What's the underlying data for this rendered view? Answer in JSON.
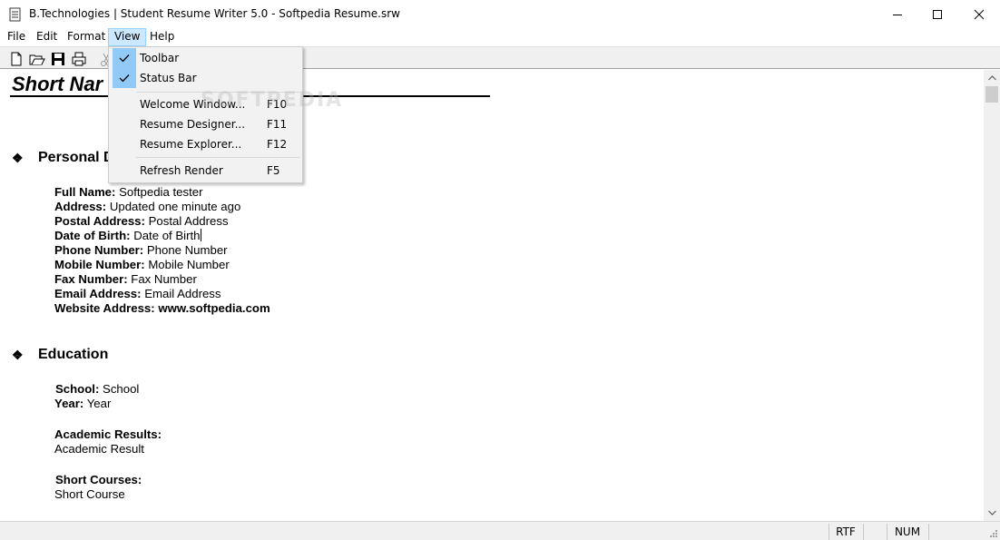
{
  "window": {
    "title": "B.Technologies | Student Resume Writer 5.0 - Softpedia Resume.srw",
    "icons": {
      "app": "document-app-icon",
      "minimize": "minimize-icon",
      "maximize": "maximize-icon",
      "close": "close-icon"
    }
  },
  "menubar": {
    "items": [
      "File",
      "Edit",
      "Format",
      "View",
      "Help"
    ],
    "active": "View"
  },
  "toolbar": {
    "buttons": [
      "new-file-icon",
      "open-folder-icon",
      "save-disk-icon",
      "print-icon",
      "cut-scissors-icon"
    ]
  },
  "view_menu": {
    "items": [
      {
        "label": "Toolbar",
        "shortcut": "",
        "checked": true
      },
      {
        "label": "Status Bar",
        "shortcut": "",
        "checked": true
      },
      {
        "label": "Welcome Window...",
        "shortcut": "F10",
        "checked": false
      },
      {
        "label": "Resume Designer...",
        "shortcut": "F11",
        "checked": false
      },
      {
        "label": "Resume Explorer...",
        "shortcut": "F12",
        "checked": false
      },
      {
        "label": "Refresh Render",
        "shortcut": "F5",
        "checked": false
      }
    ]
  },
  "document": {
    "title": "Short Nar",
    "personal": {
      "heading": "Personal D",
      "fields": [
        {
          "label": "Full Name:",
          "value": "Softpedia tester"
        },
        {
          "label": "Address:",
          "value": "Updated one minute ago"
        },
        {
          "label": "Postal Address:",
          "value": "Postal Address"
        },
        {
          "label": "Date of Birth:",
          "value": "Date of Birth"
        },
        {
          "label": "Phone Number:",
          "value": "Phone Number"
        },
        {
          "label": "Mobile Number:",
          "value": "Mobile Number"
        },
        {
          "label": "Fax Number:",
          "value": "Fax Number"
        },
        {
          "label": "Email Address:",
          "value": "Email Address"
        },
        {
          "label": "Website Address:",
          "value": "www.softpedia.com"
        }
      ]
    },
    "education": {
      "heading": "Education",
      "school_label": "School:",
      "school_value": "School",
      "year_label": "Year:",
      "year_value": "Year",
      "results_label": "Academic Results:",
      "results_value": "Academic Result",
      "courses_label": "Short Courses:",
      "courses_value": "Short Course"
    }
  },
  "watermark": "SOFTPEDIA",
  "statusbar": {
    "panes": [
      "RTF",
      "NUM"
    ]
  },
  "colors": {
    "menu_highlight": "#cce8ff",
    "check_bg": "#91c9f7",
    "chrome": "#f0f0f0"
  }
}
